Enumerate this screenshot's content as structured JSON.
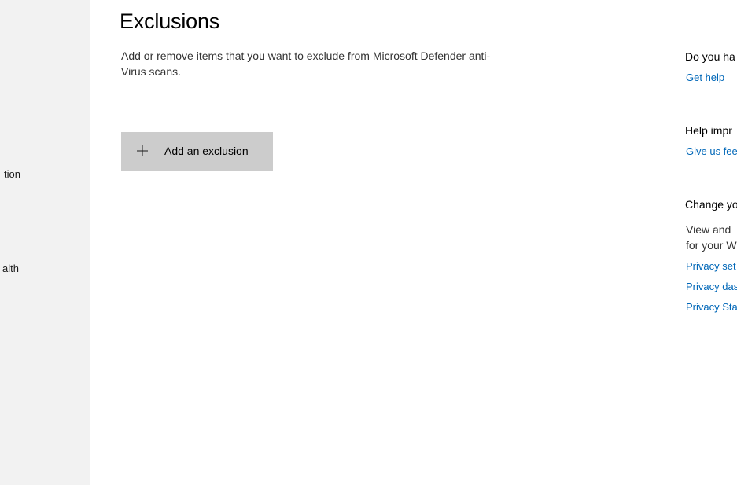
{
  "sidebar": {
    "items": [
      {
        "label": "tion"
      },
      {
        "label": "alth"
      }
    ]
  },
  "main": {
    "title": "Exclusions",
    "description": "Add or remove items that you want to exclude from Microsoft Defender anti-Virus scans.",
    "add_button_label": "Add an exclusion",
    "add_button_icon": "plus-icon"
  },
  "right_panel": {
    "help_heading": "Do you ha",
    "get_help_link": "Get help",
    "improve_heading": "Help impr",
    "feedback_link": "Give us fee",
    "privacy_heading": "Change yo",
    "privacy_text_line1": "View and",
    "privacy_text_line2": "for your W",
    "privacy_settings_link": "Privacy set",
    "privacy_dashboard_link": "Privacy das",
    "privacy_statement_link": "Privacy Sta"
  },
  "colors": {
    "sidebar_bg": "#f2f2f2",
    "button_bg": "#cccccc",
    "link": "#0067b8"
  }
}
